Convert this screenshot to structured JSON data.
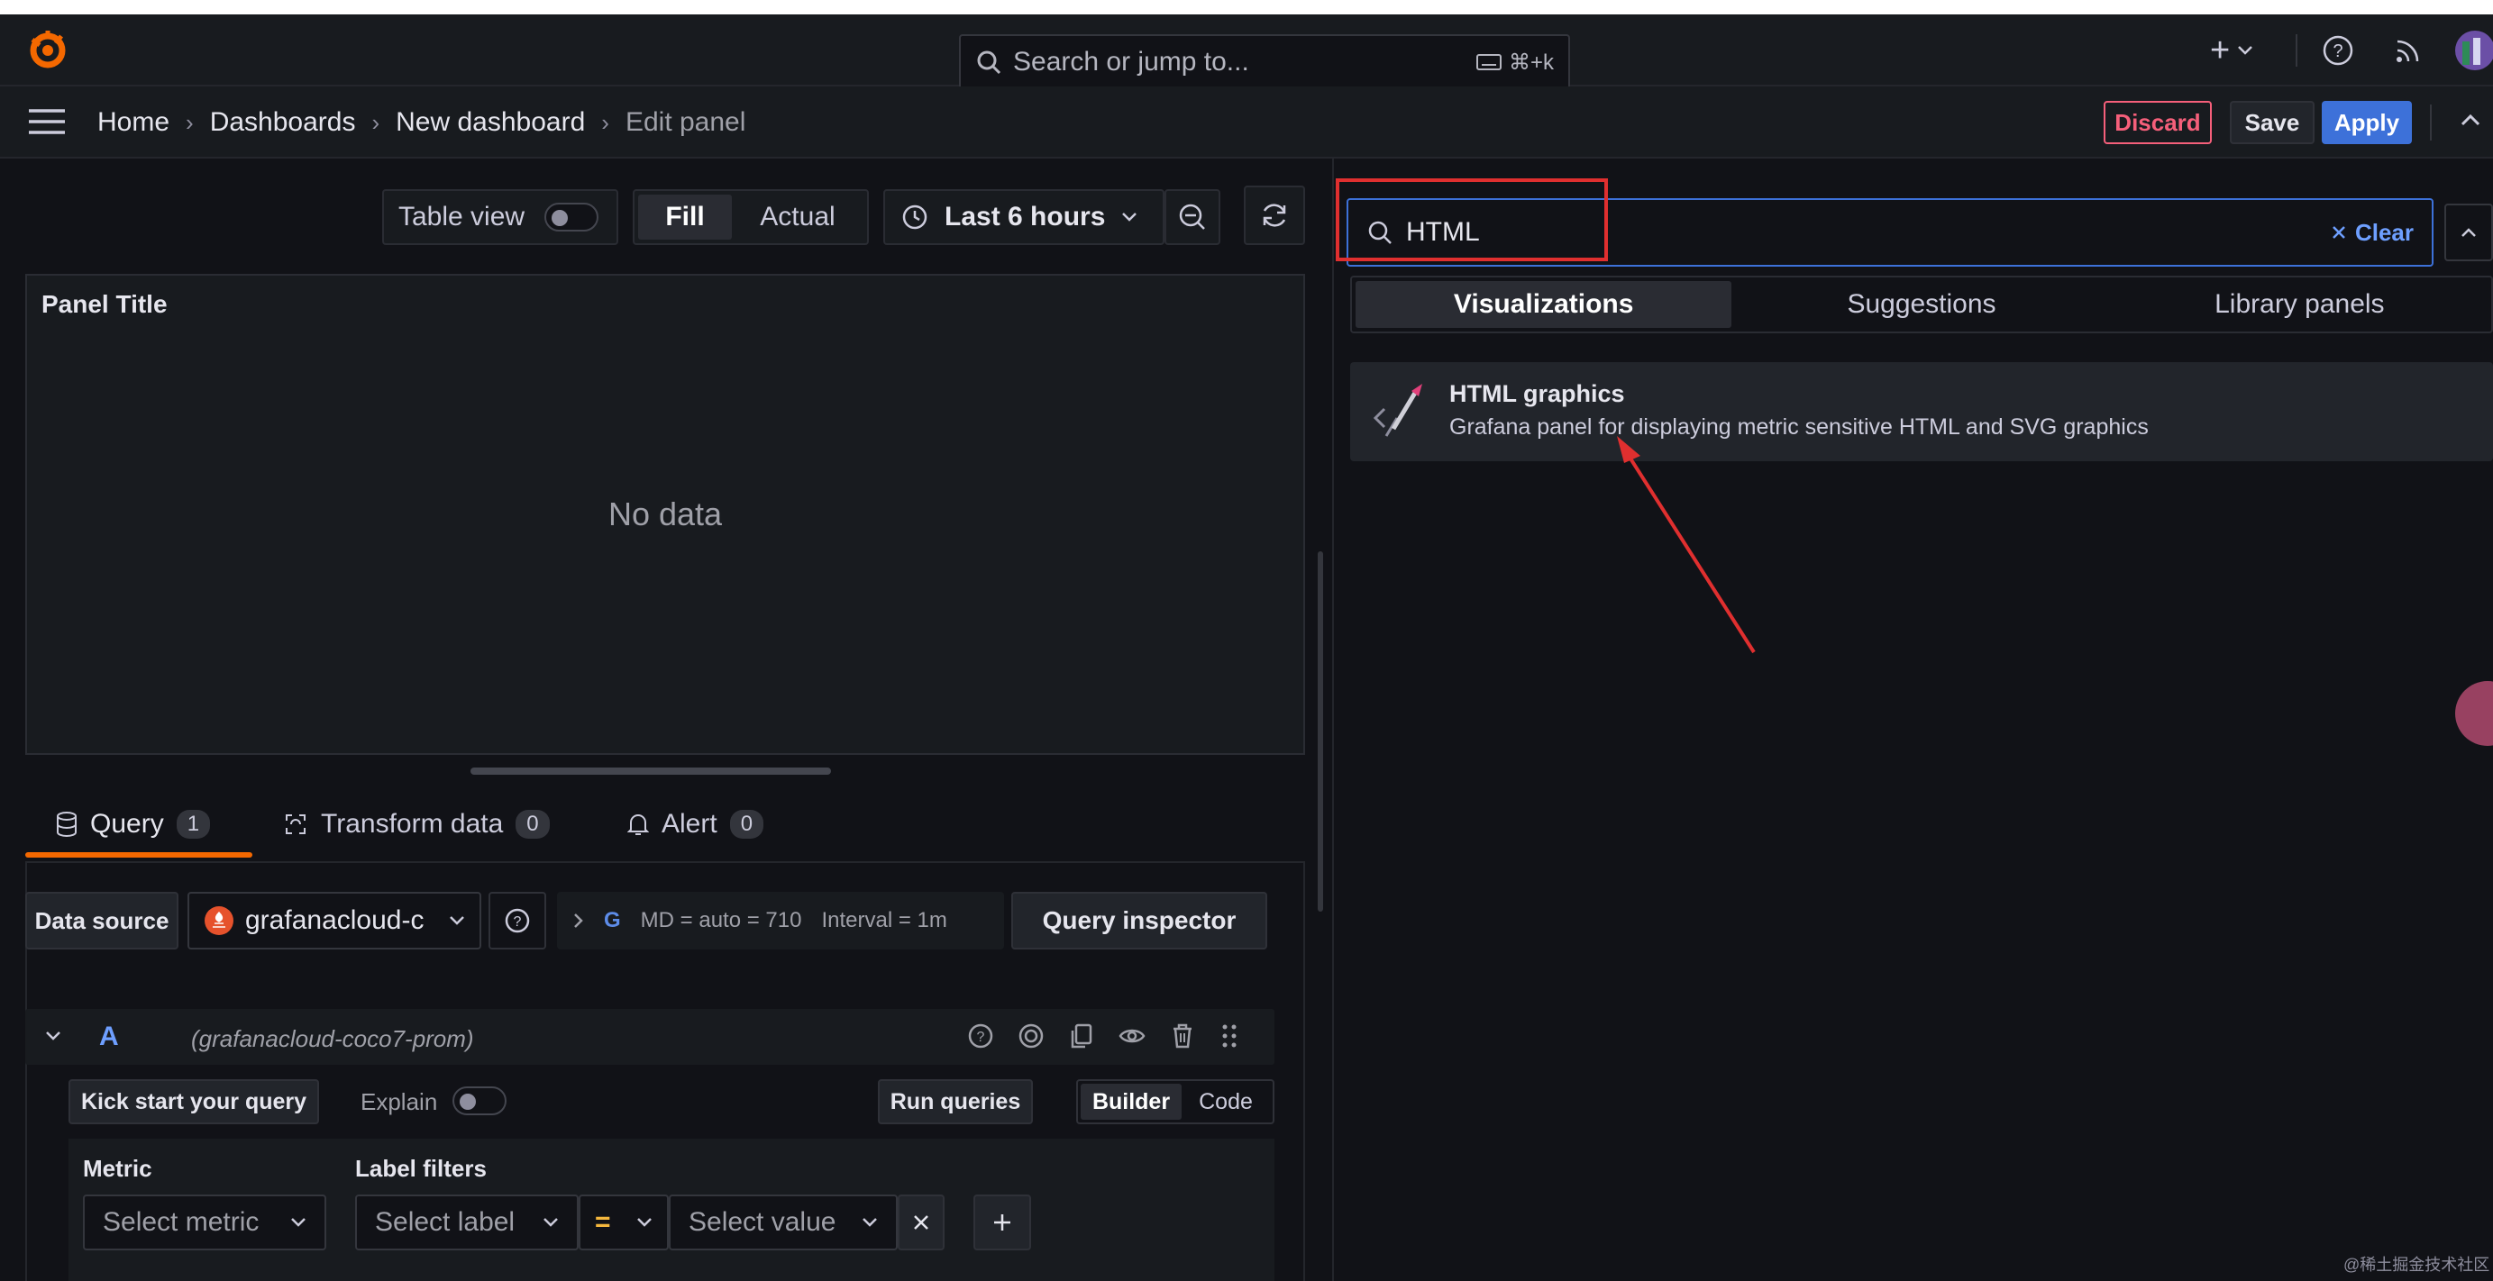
{
  "topbar": {
    "search_placeholder": "Search or jump to...",
    "search_shortcut": "⌘+k",
    "plus_label": "+"
  },
  "breadcrumb": {
    "items": [
      "Home",
      "Dashboards",
      "New dashboard",
      "Edit panel"
    ],
    "separator": "›"
  },
  "actions": {
    "discard": "Discard",
    "save": "Save",
    "apply": "Apply"
  },
  "toolbar": {
    "table_view": "Table view",
    "fill": "Fill",
    "actual": "Actual",
    "time_range": "Last 6 hours"
  },
  "panel": {
    "title": "Panel Title",
    "no_data": "No data"
  },
  "query_tabs": [
    {
      "label": "Query",
      "count": "1"
    },
    {
      "label": "Transform data",
      "count": "0"
    },
    {
      "label": "Alert",
      "count": "0"
    }
  ],
  "datasource": {
    "label": "Data source",
    "value": "grafanacloud-c",
    "md": "MD = auto = 710",
    "interval": "Interval = 1m",
    "inspector": "Query inspector"
  },
  "query_row": {
    "letter": "A",
    "source": "(grafanacloud-coco7-prom)",
    "kick_start": "Kick start your query",
    "explain": "Explain",
    "run": "Run queries",
    "builder": "Builder",
    "code": "Code"
  },
  "builder": {
    "metric_label": "Metric",
    "metric_placeholder": "Select metric",
    "label_filters": "Label filters",
    "label_placeholder": "Select label",
    "operator": "=",
    "value_placeholder": "Select value"
  },
  "viz_picker": {
    "search_value": "HTML",
    "clear": "Clear",
    "tabs": [
      "Visualizations",
      "Suggestions",
      "Library panels"
    ],
    "result_title": "HTML graphics",
    "result_desc": "Grafana panel for displaying metric sensitive HTML and SVG graphics"
  },
  "watermark": "@稀土掘金技术社区",
  "colors": {
    "accent_blue": "#3d71d9",
    "discard_red": "#f55f7a",
    "query_tab_underline": "#f46800",
    "highlight_box": "#e02f2f",
    "annotation_arrow": "#e02f2f"
  }
}
